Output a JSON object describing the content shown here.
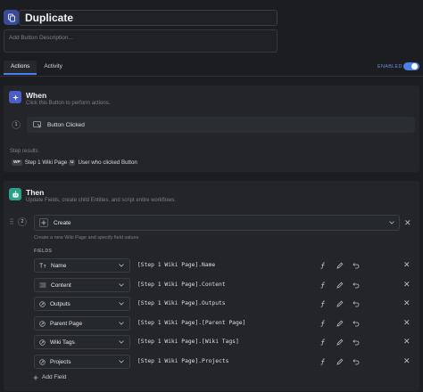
{
  "header": {
    "title": "Duplicate",
    "description_placeholder": "Add Button Description..."
  },
  "tabs": [
    {
      "label": "Actions",
      "active": true
    },
    {
      "label": "Activity",
      "active": false
    }
  ],
  "status": {
    "enabled_label": "ENABLED",
    "enabled": true
  },
  "when": {
    "title": "When",
    "subtitle": "Click this Button to perform actions.",
    "step_number": "1",
    "trigger_label": "Button Clicked",
    "step_results_label": "Step results",
    "results": [
      {
        "tag": "WP",
        "label": "Step 1 Wiki Page"
      },
      {
        "tag": "U",
        "label": "User who clicked Button"
      }
    ]
  },
  "then": {
    "title": "Then",
    "subtitle": "Update Fields, create child Entities, and script entire workflows.",
    "step_number": "2",
    "action_label": "Create",
    "action_hint": "Create a new Wiki Page and specify field values",
    "fields_label": "FIELDS",
    "fields": [
      {
        "name": "Name",
        "icon": "text-type-icon",
        "value": "[Step 1 Wiki Page].Name"
      },
      {
        "name": "Content",
        "icon": "rich-text-icon",
        "value": "[Step 1 Wiki Page].Content"
      },
      {
        "name": "Outputs",
        "icon": "link-entity-icon",
        "value": "[Step 1 Wiki Page].Outputs"
      },
      {
        "name": "Parent Page",
        "icon": "link-entity-icon",
        "value": "[Step 1 Wiki Page].[Parent Page]"
      },
      {
        "name": "Wiki Tags",
        "icon": "link-entity-icon",
        "value": "[Step 1 Wiki Page].[Wiki Tags]"
      },
      {
        "name": "Projects",
        "icon": "link-entity-icon",
        "value": "[Step 1 Wiki Page].Projects"
      }
    ],
    "add_field_label": "Add Field"
  },
  "colors": {
    "accent": "#4a7ee8",
    "when_icon_bg": "#4b5cc7",
    "then_icon_bg": "#27a38a",
    "background": "#1b1d21",
    "panel": "#232529"
  }
}
